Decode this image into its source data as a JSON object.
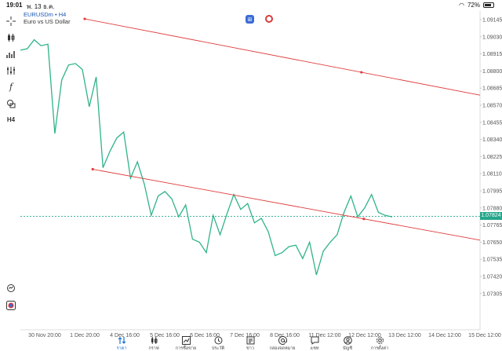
{
  "status_bar": {
    "time": "19:01",
    "date": "พ. 13 ธ.ค.",
    "battery": "72%",
    "battery_level": 0.72
  },
  "symbol": {
    "name": "EURUSDm • H4",
    "description": "Euro vs US Dollar"
  },
  "toolbar": {
    "timeframe": "H4",
    "function_label": "f"
  },
  "current_price": "1.07824",
  "chart_data": {
    "type": "line",
    "x_tick_labels": [
      "30 Nov 20:00",
      "1 Dec 20:00",
      "4 Dec 16:00",
      "5 Dec 16:00",
      "6 Dec 16:00",
      "7 Dec 16:00",
      "8 Dec 16:00",
      "11 Dec 12:00",
      "12 Dec 12:00",
      "13 Dec 12:00",
      "14 Dec 12:00",
      "15 Dec 12:00"
    ],
    "y_tick_labels": [
      "1.09145",
      "1.09030",
      "1.08915",
      "1.08800",
      "1.08685",
      "1.08570",
      "1.08455",
      "1.08340",
      "1.08225",
      "1.08110",
      "1.07995",
      "1.07880",
      "1.07765",
      "1.07650",
      "1.07535",
      "1.07420",
      "1.07305"
    ],
    "ylim": [
      1.0725,
      1.0922
    ],
    "series": [
      {
        "values": [
          1.0894,
          1.0895,
          1.0901,
          1.0897,
          1.0898,
          1.0838,
          1.0874,
          1.0884,
          1.0885,
          1.0881,
          1.0856,
          1.0876,
          1.0815,
          1.0826,
          1.0835,
          1.0839,
          1.0808,
          1.0819,
          1.0804,
          1.0783,
          1.0796,
          1.0799,
          1.0794,
          1.0782,
          1.079,
          1.0767,
          1.0765,
          1.0758,
          1.0783,
          1.077,
          1.0784,
          1.0797,
          1.0787,
          1.0791,
          1.0778,
          1.0781,
          1.0772,
          1.0756,
          1.0758,
          1.0762,
          1.0763,
          1.0754,
          1.0765,
          1.0743,
          1.0759,
          1.0765,
          1.077,
          1.0785,
          1.0796,
          1.0782,
          1.0788,
          1.0797,
          1.0785,
          1.0783,
          1.0782
        ]
      }
    ],
    "trendlines": [
      {
        "start": [
          1.0,
          1.0915
        ],
        "end": [
          14.5,
          1.0845
        ]
      },
      {
        "start": [
          1.2,
          1.0814
        ],
        "end": [
          13.8,
          1.0752
        ]
      }
    ],
    "colors": {
      "line": "#2fb38a",
      "trendline": "#e03c3c",
      "current_price": "#26a68a"
    }
  },
  "nav": [
    {
      "icon": "quotes-icon",
      "label": "ราคา",
      "active": true
    },
    {
      "icon": "chart-icon",
      "label": "กราฟ",
      "active": false
    },
    {
      "icon": "trade-icon",
      "label": "การซื้อขาย",
      "active": false
    },
    {
      "icon": "history-icon",
      "label": "ประวัติ",
      "active": false
    },
    {
      "icon": "news-icon",
      "label": "ข่าว",
      "active": false
    },
    {
      "icon": "mailbox-icon",
      "label": "กล่องจดหมาย",
      "active": false
    },
    {
      "icon": "chat-icon",
      "label": "แชท",
      "active": false
    },
    {
      "icon": "account-icon",
      "label": "บัญชี",
      "active": false
    },
    {
      "icon": "settings-icon",
      "label": "การตั้งค่า",
      "active": false
    }
  ]
}
